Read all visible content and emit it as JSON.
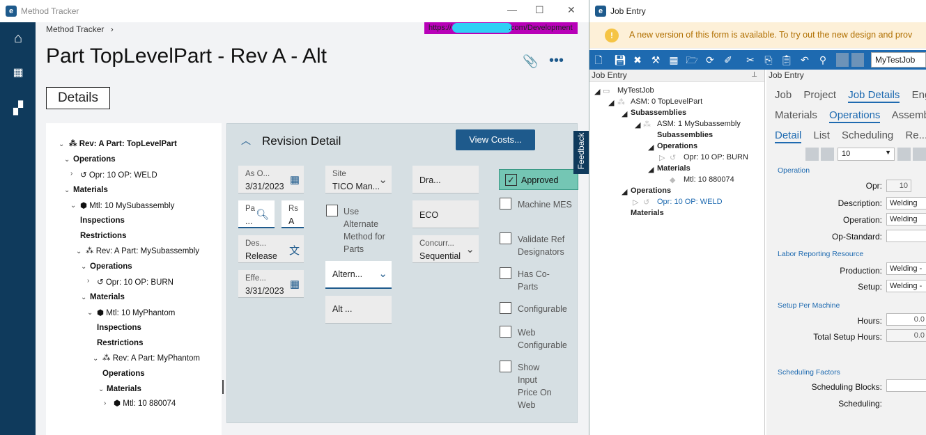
{
  "left_window": {
    "title": "Method Tracker",
    "breadcrumb": "Method Tracker",
    "breadcrumb_sep": "›",
    "url": "https://",
    "url_suffix": ".com/Development",
    "page_title": "Part TopLevelPart - Rev A - Alt",
    "details_label": "Details",
    "tree": [
      {
        "label": "Rev: A Part: TopLevelPart",
        "bold": true
      },
      {
        "label": "Operations",
        "bold": true
      },
      {
        "label": "Opr: 10 OP: WELD",
        "bold": false
      },
      {
        "label": "Materials",
        "bold": true
      },
      {
        "label": "Mtl: 10 MySubassembly",
        "bold": false
      },
      {
        "label": "Inspections",
        "bold": true
      },
      {
        "label": "Restrictions",
        "bold": true
      },
      {
        "label": "Rev: A Part: MySubassembly",
        "bold": false
      },
      {
        "label": "Operations",
        "bold": true
      },
      {
        "label": "Opr: 10 OP: BURN",
        "bold": false
      },
      {
        "label": "Materials",
        "bold": true
      },
      {
        "label": "Mtl: 10 MyPhantom",
        "bold": false
      },
      {
        "label": "Inspections",
        "bold": true
      },
      {
        "label": "Restrictions",
        "bold": true
      },
      {
        "label": "Rev: A Part: MyPhantom",
        "bold": false
      },
      {
        "label": "Operations",
        "bold": true
      },
      {
        "label": "Materials",
        "bold": true
      },
      {
        "label": "Mtl: 10 880074",
        "bold": false
      }
    ],
    "panel": {
      "title": "Revision Detail",
      "view_costs": "View Costs...",
      "fields": {
        "as_of_label": "As O...",
        "as_of_value": "3/31/2023",
        "pa_label": "Pa",
        "pa_value": "...",
        "rs_label": "Rs",
        "rs_value": "A",
        "des_label": "Des...",
        "des_value": "Release",
        "eff_label": "Effe...",
        "eff_value": "3/31/2023",
        "site_label": "Site",
        "site_value": "TICO Man...",
        "use_alt_label": "Use Alternate Method for Parts",
        "altern_value": "Altern...",
        "alt_value": "Alt ...",
        "dra_value": "Dra...",
        "eco_value": "ECO",
        "concur_label": "Concurr...",
        "concur_value": "Sequential"
      },
      "checks": {
        "approved": "Approved",
        "machine_mes": "Machine MES",
        "validate_ref": "Validate Ref Designators",
        "has_co_parts": "Has Co-Parts",
        "configurable": "Configurable",
        "web_configurable": "Web Configurable",
        "show_input_price": "Show Input Price On Web"
      }
    },
    "feedback": "Feedback"
  },
  "right_window": {
    "title": "Job Entry",
    "banner": "A new version of this form is available. To try out the new design and prov",
    "job_selector": "MyTestJob",
    "tree_header": "Job Entry",
    "tree": [
      {
        "label": "MyTestJob",
        "bold": false
      },
      {
        "label": "ASM: 0 TopLevelPart",
        "bold": false
      },
      {
        "label": "Subassemblies",
        "bold": true
      },
      {
        "label": "ASM: 1 MySubassembly",
        "bold": false
      },
      {
        "label": "Subassemblies",
        "bold": true
      },
      {
        "label": "Operations",
        "bold": true
      },
      {
        "label": "Opr: 10 OP: BURN",
        "bold": false
      },
      {
        "label": "Materials",
        "bold": true
      },
      {
        "label": "Mtl: 10 880074",
        "bold": false
      },
      {
        "label": "Operations",
        "bold": true
      },
      {
        "label": "Opr: 10 OP: WELD",
        "bold": false
      },
      {
        "label": "Materials",
        "bold": true
      }
    ],
    "detail_header": "Job Entry",
    "tabs1": [
      "Job",
      "Project",
      "Job Details",
      "Eng"
    ],
    "tabs2": [
      "Materials",
      "Operations",
      "Assemb"
    ],
    "tabs3": [
      "Detail",
      "List",
      "Scheduling",
      "Re..."
    ],
    "record_nav_value": "10",
    "sections": {
      "operation": "Operation",
      "labor": "Labor Reporting Resource",
      "setup": "Setup Per Machine",
      "sched": "Scheduling Factors"
    },
    "fields": {
      "opr_label": "Opr:",
      "opr_value": "10",
      "desc_label": "Description:",
      "desc_value": "Welding",
      "operation_label": "Operation:",
      "operation_value": "Welding",
      "opstd_label": "Op-Standard:",
      "production_label": "Production:",
      "production_value": "Welding -",
      "setup_label": "Setup:",
      "setup_value": "Welding -",
      "hours_label": "Hours:",
      "hours_value": "0.0",
      "total_setup_label": "Total Setup Hours:",
      "total_setup_value": "0.0",
      "sched_blocks_label": "Scheduling Blocks:",
      "scheduling_label": "Scheduling:"
    }
  }
}
